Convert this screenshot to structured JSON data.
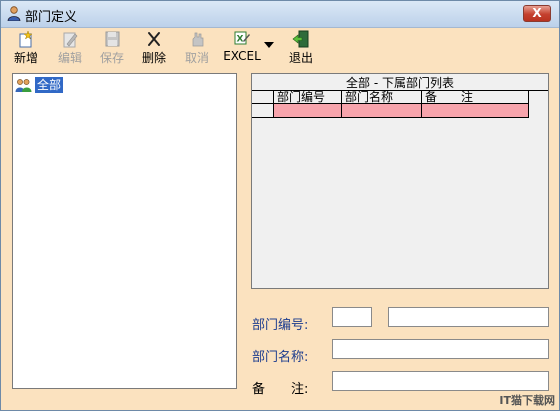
{
  "window": {
    "title": "部门定义",
    "close_glyph": "X"
  },
  "toolbar": {
    "new_label": "新增",
    "edit_label": "编辑",
    "save_label": "保存",
    "delete_label": "删除",
    "cancel_label": "取消",
    "excel_label": "EXCEL",
    "exit_label": "退出"
  },
  "tree": {
    "root_label": "全部"
  },
  "grid": {
    "caption": "全部 - 下属部门列表",
    "columns": [
      "部门编号",
      "部门名称",
      "备　　注"
    ],
    "rows": [
      [
        "",
        "",
        ""
      ]
    ]
  },
  "form": {
    "code_label": "部门编号:",
    "name_label": "部门名称:",
    "note_label": "备　　注:",
    "code_value": "",
    "code_extra_value": "",
    "name_value": "",
    "note_value": ""
  },
  "watermark": "IT猫下载网",
  "colors": {
    "window_bg": "#fbe2bf",
    "selection": "#3169c6",
    "grid_row": "#f7a4ac",
    "form_label": "#1d3d8f"
  }
}
